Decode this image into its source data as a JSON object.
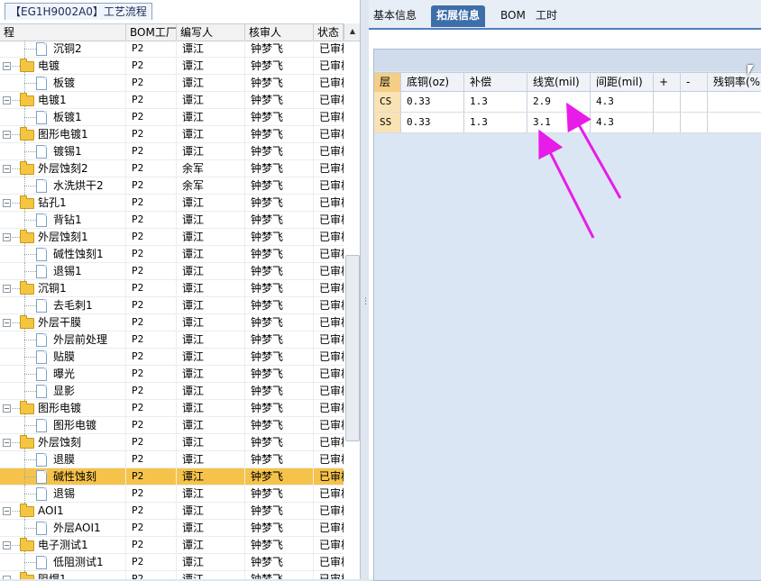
{
  "left_panel": {
    "title": "【EG1H9002A0】工艺流程",
    "columns": [
      "程",
      "BOM工厂",
      "编写人",
      "核审人",
      "状态"
    ],
    "rows": [
      {
        "label": "沉铜2",
        "type": "child",
        "bom": "P2",
        "writer": "谭江",
        "reviewer": "钟梦飞",
        "status": "已审核"
      },
      {
        "label": "电镀",
        "type": "parent",
        "bom": "P2",
        "writer": "谭江",
        "reviewer": "钟梦飞",
        "status": "已审核"
      },
      {
        "label": "板镀",
        "type": "child",
        "bom": "P2",
        "writer": "谭江",
        "reviewer": "钟梦飞",
        "status": "已审核"
      },
      {
        "label": "电镀1",
        "type": "parent",
        "bom": "P2",
        "writer": "谭江",
        "reviewer": "钟梦飞",
        "status": "已审核"
      },
      {
        "label": "板镀1",
        "type": "child",
        "bom": "P2",
        "writer": "谭江",
        "reviewer": "钟梦飞",
        "status": "已审核"
      },
      {
        "label": "图形电镀1",
        "type": "parent",
        "bom": "P2",
        "writer": "谭江",
        "reviewer": "钟梦飞",
        "status": "已审核"
      },
      {
        "label": "镀锡1",
        "type": "child",
        "bom": "P2",
        "writer": "谭江",
        "reviewer": "钟梦飞",
        "status": "已审核"
      },
      {
        "label": "外层蚀刻2",
        "type": "parent",
        "bom": "P2",
        "writer": "余军",
        "reviewer": "钟梦飞",
        "status": "已审核"
      },
      {
        "label": "水洗烘干2",
        "type": "child",
        "bom": "P2",
        "writer": "余军",
        "reviewer": "钟梦飞",
        "status": "已审核"
      },
      {
        "label": "钻孔1",
        "type": "parent",
        "bom": "P2",
        "writer": "谭江",
        "reviewer": "钟梦飞",
        "status": "已审核"
      },
      {
        "label": "背钻1",
        "type": "child",
        "bom": "P2",
        "writer": "谭江",
        "reviewer": "钟梦飞",
        "status": "已审核"
      },
      {
        "label": "外层蚀刻1",
        "type": "parent",
        "bom": "P2",
        "writer": "谭江",
        "reviewer": "钟梦飞",
        "status": "已审核"
      },
      {
        "label": "碱性蚀刻1",
        "type": "child",
        "bom": "P2",
        "writer": "谭江",
        "reviewer": "钟梦飞",
        "status": "已审核"
      },
      {
        "label": "退锡1",
        "type": "child",
        "bom": "P2",
        "writer": "谭江",
        "reviewer": "钟梦飞",
        "status": "已审核"
      },
      {
        "label": "沉铜1",
        "type": "parent",
        "bom": "P2",
        "writer": "谭江",
        "reviewer": "钟梦飞",
        "status": "已审核"
      },
      {
        "label": "去毛刺1",
        "type": "child",
        "bom": "P2",
        "writer": "谭江",
        "reviewer": "钟梦飞",
        "status": "已审核"
      },
      {
        "label": "外层干膜",
        "type": "parent",
        "bom": "P2",
        "writer": "谭江",
        "reviewer": "钟梦飞",
        "status": "已审核"
      },
      {
        "label": "外层前处理",
        "type": "child",
        "bom": "P2",
        "writer": "谭江",
        "reviewer": "钟梦飞",
        "status": "已审核"
      },
      {
        "label": "贴膜",
        "type": "child",
        "bom": "P2",
        "writer": "谭江",
        "reviewer": "钟梦飞",
        "status": "已审核"
      },
      {
        "label": "曝光",
        "type": "child",
        "bom": "P2",
        "writer": "谭江",
        "reviewer": "钟梦飞",
        "status": "已审核"
      },
      {
        "label": "显影",
        "type": "child",
        "bom": "P2",
        "writer": "谭江",
        "reviewer": "钟梦飞",
        "status": "已审核"
      },
      {
        "label": "图形电镀",
        "type": "parent",
        "bom": "P2",
        "writer": "谭江",
        "reviewer": "钟梦飞",
        "status": "已审核"
      },
      {
        "label": "图形电镀",
        "type": "child",
        "bom": "P2",
        "writer": "谭江",
        "reviewer": "钟梦飞",
        "status": "已审核"
      },
      {
        "label": "外层蚀刻",
        "type": "parent",
        "bom": "P2",
        "writer": "谭江",
        "reviewer": "钟梦飞",
        "status": "已审核"
      },
      {
        "label": "退膜",
        "type": "child",
        "bom": "P2",
        "writer": "谭江",
        "reviewer": "钟梦飞",
        "status": "已审核"
      },
      {
        "label": "碱性蚀刻",
        "type": "child",
        "bom": "P2",
        "writer": "谭江",
        "reviewer": "钟梦飞",
        "status": "已审核",
        "selected": true
      },
      {
        "label": "退锡",
        "type": "child",
        "bom": "P2",
        "writer": "谭江",
        "reviewer": "钟梦飞",
        "status": "已审核"
      },
      {
        "label": "AOI1",
        "type": "parent",
        "bom": "P2",
        "writer": "谭江",
        "reviewer": "钟梦飞",
        "status": "已审核"
      },
      {
        "label": "外层AOI1",
        "type": "child",
        "bom": "P2",
        "writer": "谭江",
        "reviewer": "钟梦飞",
        "status": "已审核"
      },
      {
        "label": "电子测试1",
        "type": "parent",
        "bom": "P2",
        "writer": "谭江",
        "reviewer": "钟梦飞",
        "status": "已审核"
      },
      {
        "label": "低阻测试1",
        "type": "child",
        "bom": "P2",
        "writer": "谭江",
        "reviewer": "钟梦飞",
        "status": "已审核"
      },
      {
        "label": "阻焊1",
        "type": "parent",
        "bom": "P2",
        "writer": "谭江",
        "reviewer": "钟梦飞",
        "status": "已审核"
      }
    ]
  },
  "tabs": [
    {
      "label": "基本信息",
      "active": false
    },
    {
      "label": "拓展信息",
      "active": true
    },
    {
      "label": "BOM",
      "active": false
    },
    {
      "label": "工时",
      "active": false
    }
  ],
  "grid": {
    "columns": [
      "层",
      "底铜(oz)",
      "补偿",
      "线宽(mil)",
      "间距(mil)",
      "+",
      "-",
      "残铜率(%)"
    ],
    "rows": [
      {
        "layer": "CS",
        "base_copper": "0.33",
        "compensation": "1.3",
        "line_width": "2.9",
        "spacing": "4.3"
      },
      {
        "layer": "SS",
        "base_copper": "0.33",
        "compensation": "1.3",
        "line_width": "3.1",
        "spacing": "4.3"
      }
    ]
  },
  "colors": {
    "tab_active": "#3e6ea9",
    "row_selected": "#f6c34a",
    "annotation_arrow": "#e81ce8"
  },
  "icons": {
    "folder": "folder-icon",
    "doc": "document-icon",
    "expand": "minus-box-icon"
  }
}
